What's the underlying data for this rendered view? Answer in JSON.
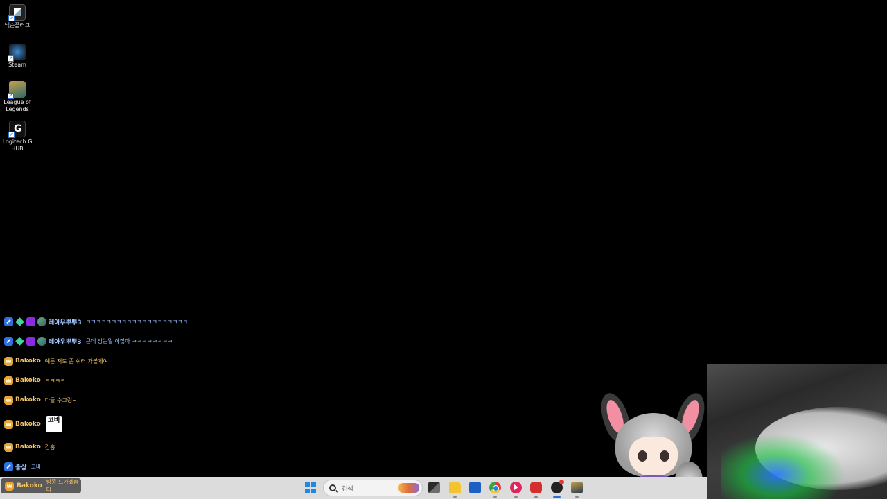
{
  "desktop": {
    "icons": [
      {
        "label": "넥슨플러그",
        "icon": "nexon-plug-icon"
      },
      {
        "label": "Steam",
        "icon": "steam-icon"
      },
      {
        "label": "League of Legends",
        "icon": "league-of-legends-icon"
      },
      {
        "label": "Logitech G HUB",
        "icon": "logitech-ghub-icon"
      }
    ]
  },
  "chat": {
    "messages": [
      {
        "user": "레아우뿌뿌3",
        "text": "ㅋㅋㅋㅋㅋㅋㅋㅋㅋㅋㅋㅋㅋㅋㅋㅋㅋㅋㅋㅋ",
        "badges": [
          "pen-badge",
          "gem-badge",
          "subscriber-badge",
          "emote-badge"
        ]
      },
      {
        "user": "레아우뿌뿌3",
        "text": "근데 망는말 이잖아 ㅋㅋㅋㅋㅋㅋㅋㅋ",
        "badges": [
          "pen-badge",
          "gem-badge",
          "subscriber-badge",
          "emote-badge"
        ]
      },
      {
        "user": "Bakoko",
        "text": "예튼 저도 좀 쉬러 가볼게여",
        "badges": [
          "crown-badge"
        ]
      },
      {
        "user": "Bakoko",
        "text": "ㅋㅋㅋㅋ",
        "badges": [
          "crown-badge"
        ]
      },
      {
        "user": "Bakoko",
        "text": "다들 수고링~",
        "badges": [
          "crown-badge"
        ]
      },
      {
        "user": "Bakoko",
        "text": "",
        "emote": "코바",
        "badges": [
          "crown-badge"
        ]
      },
      {
        "user": "Bakoko",
        "text": "감홍",
        "badges": [
          "crown-badge"
        ]
      },
      {
        "user": "중상",
        "text": "코바",
        "badges": [
          "pen-badge"
        ]
      },
      {
        "user": "Bakoko",
        "text": "방종 드가겠습다",
        "badges": [
          "crown-badge"
        ]
      }
    ]
  },
  "taskbar": {
    "search_placeholder": "검색",
    "apps": [
      {
        "name": "task-view-icon"
      },
      {
        "name": "file-explorer-icon"
      },
      {
        "name": "microsoft-store-icon"
      },
      {
        "name": "chrome-icon"
      },
      {
        "name": "youtube-music-icon"
      },
      {
        "name": "recorder-icon"
      },
      {
        "name": "obs-icon"
      },
      {
        "name": "league-client-icon"
      }
    ]
  },
  "colors": {
    "desktop_bg": "#000000",
    "taskbar_bg": "#dcdcdc",
    "accent": "#1e88e5",
    "chat_blue": "#9fc6ff",
    "chat_gold": "#f2c46b"
  }
}
